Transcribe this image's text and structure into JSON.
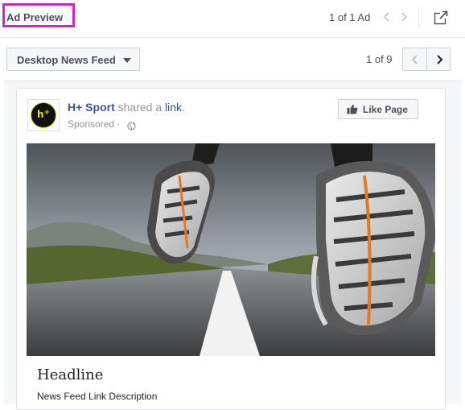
{
  "header": {
    "title": "Ad Preview",
    "ad_count": "1 of 1 Ad",
    "prev_icon": "chevron-left-icon",
    "next_icon": "chevron-right-icon",
    "external_icon": "external-link-icon"
  },
  "toolbar": {
    "placement": "Desktop News Feed",
    "page_count": "1 of 9"
  },
  "post": {
    "page_name": "H+ Sport",
    "shared_text": " shared a ",
    "link_text": "link",
    "link_suffix": ".",
    "sponsored": "Sponsored · ",
    "like_button": "Like Page",
    "headline": "Headline",
    "description": "News Feed Link Description"
  },
  "colors": {
    "highlight": "#d024c4",
    "link": "#365899",
    "brand_accent": "#d8e600"
  }
}
